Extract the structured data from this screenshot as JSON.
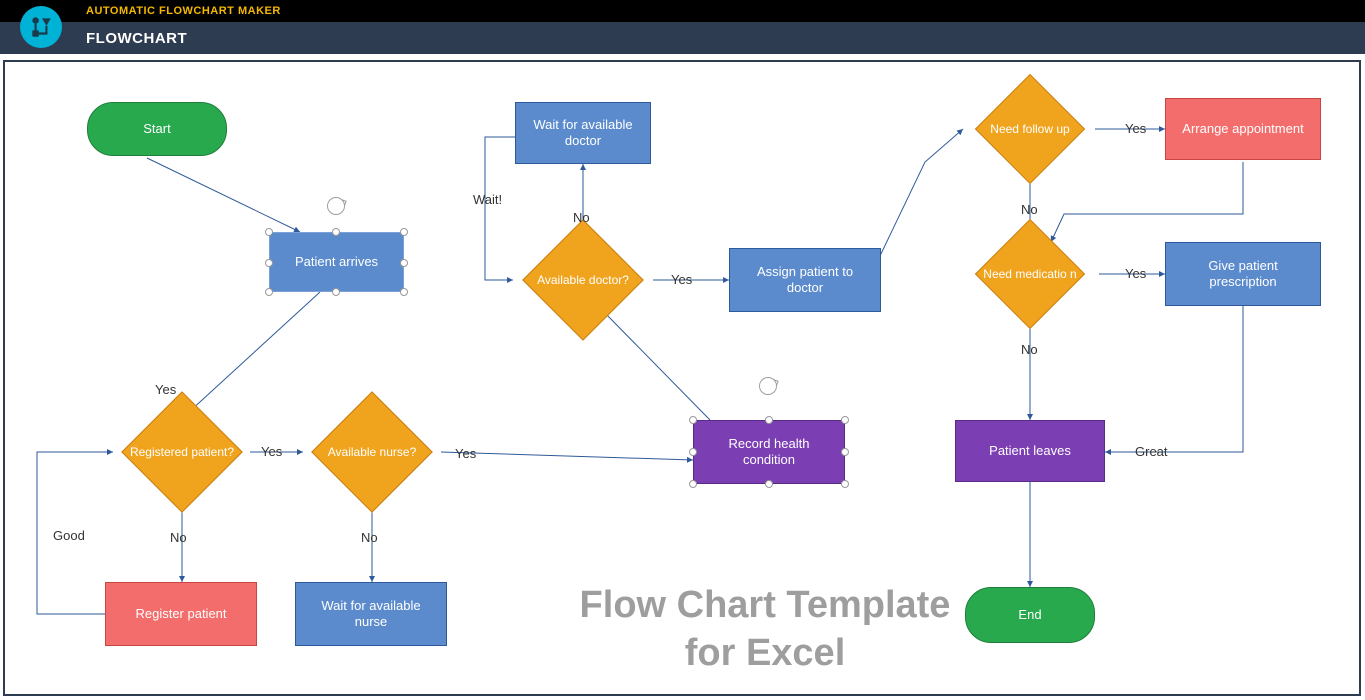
{
  "header": {
    "product": "AUTOMATIC FLOWCHART MAKER",
    "section": "FLOWCHART"
  },
  "watermark": {
    "line1": "Flow Chart Template",
    "line2": "for Excel"
  },
  "nodes": {
    "start": "Start",
    "patient_arrives": "Patient arrives",
    "registered_patient": "Registered patient?",
    "register_patient": "Register patient",
    "available_nurse": "Available nurse?",
    "wait_nurse": "Wait for available nurse",
    "record_health": "Record health condition",
    "available_doctor": "Available doctor?",
    "wait_doctor": "Wait for available doctor",
    "assign_doctor": "Assign patient to doctor",
    "need_followup": "Need follow up",
    "arrange_appt": "Arrange appointment",
    "need_medication": "Need medicatio n",
    "give_prescription": "Give patient prescription",
    "patient_leaves": "Patient leaves",
    "end": "End"
  },
  "labels": {
    "yes": "Yes",
    "no": "No",
    "wait": "Wait!",
    "good": "Good",
    "great": "Great"
  },
  "chart_data": {
    "type": "flowchart",
    "title": "Flow Chart Template for Excel",
    "nodes": [
      {
        "id": "start",
        "kind": "terminator",
        "label": "Start"
      },
      {
        "id": "patient_arrives",
        "kind": "process",
        "label": "Patient arrives"
      },
      {
        "id": "registered_patient",
        "kind": "decision",
        "label": "Registered patient?"
      },
      {
        "id": "register_patient",
        "kind": "action",
        "label": "Register patient"
      },
      {
        "id": "available_nurse",
        "kind": "decision",
        "label": "Available nurse?"
      },
      {
        "id": "wait_nurse",
        "kind": "process",
        "label": "Wait for available nurse"
      },
      {
        "id": "record_health",
        "kind": "milestone",
        "label": "Record health condition"
      },
      {
        "id": "available_doctor",
        "kind": "decision",
        "label": "Available doctor?"
      },
      {
        "id": "wait_doctor",
        "kind": "process",
        "label": "Wait for available doctor"
      },
      {
        "id": "assign_doctor",
        "kind": "process",
        "label": "Assign patient to doctor"
      },
      {
        "id": "need_followup",
        "kind": "decision",
        "label": "Need follow up"
      },
      {
        "id": "arrange_appt",
        "kind": "action",
        "label": "Arrange appointment"
      },
      {
        "id": "need_medication",
        "kind": "decision",
        "label": "Need medication"
      },
      {
        "id": "give_prescription",
        "kind": "process",
        "label": "Give patient prescription"
      },
      {
        "id": "patient_leaves",
        "kind": "milestone",
        "label": "Patient leaves"
      },
      {
        "id": "end",
        "kind": "terminator",
        "label": "End"
      }
    ],
    "edges": [
      {
        "from": "start",
        "to": "patient_arrives"
      },
      {
        "from": "patient_arrives",
        "to": "registered_patient",
        "label": "Yes"
      },
      {
        "from": "registered_patient",
        "to": "register_patient",
        "label": "No"
      },
      {
        "from": "register_patient",
        "to": "registered_patient",
        "label": "Good"
      },
      {
        "from": "registered_patient",
        "to": "available_nurse",
        "label": "Yes"
      },
      {
        "from": "available_nurse",
        "to": "wait_nurse",
        "label": "No"
      },
      {
        "from": "available_nurse",
        "to": "record_health",
        "label": "Yes"
      },
      {
        "from": "record_health",
        "to": "available_doctor"
      },
      {
        "from": "available_doctor",
        "to": "wait_doctor",
        "label": "No"
      },
      {
        "from": "wait_doctor",
        "to": "available_doctor",
        "label": "Wait!"
      },
      {
        "from": "available_doctor",
        "to": "assign_doctor",
        "label": "Yes"
      },
      {
        "from": "assign_doctor",
        "to": "need_followup"
      },
      {
        "from": "need_followup",
        "to": "arrange_appt",
        "label": "Yes"
      },
      {
        "from": "need_followup",
        "to": "need_medication",
        "label": "No"
      },
      {
        "from": "arrange_appt",
        "to": "need_medication"
      },
      {
        "from": "need_medication",
        "to": "give_prescription",
        "label": "Yes"
      },
      {
        "from": "need_medication",
        "to": "patient_leaves",
        "label": "No"
      },
      {
        "from": "give_prescription",
        "to": "patient_leaves",
        "label": "Great"
      },
      {
        "from": "patient_leaves",
        "to": "end"
      }
    ]
  }
}
